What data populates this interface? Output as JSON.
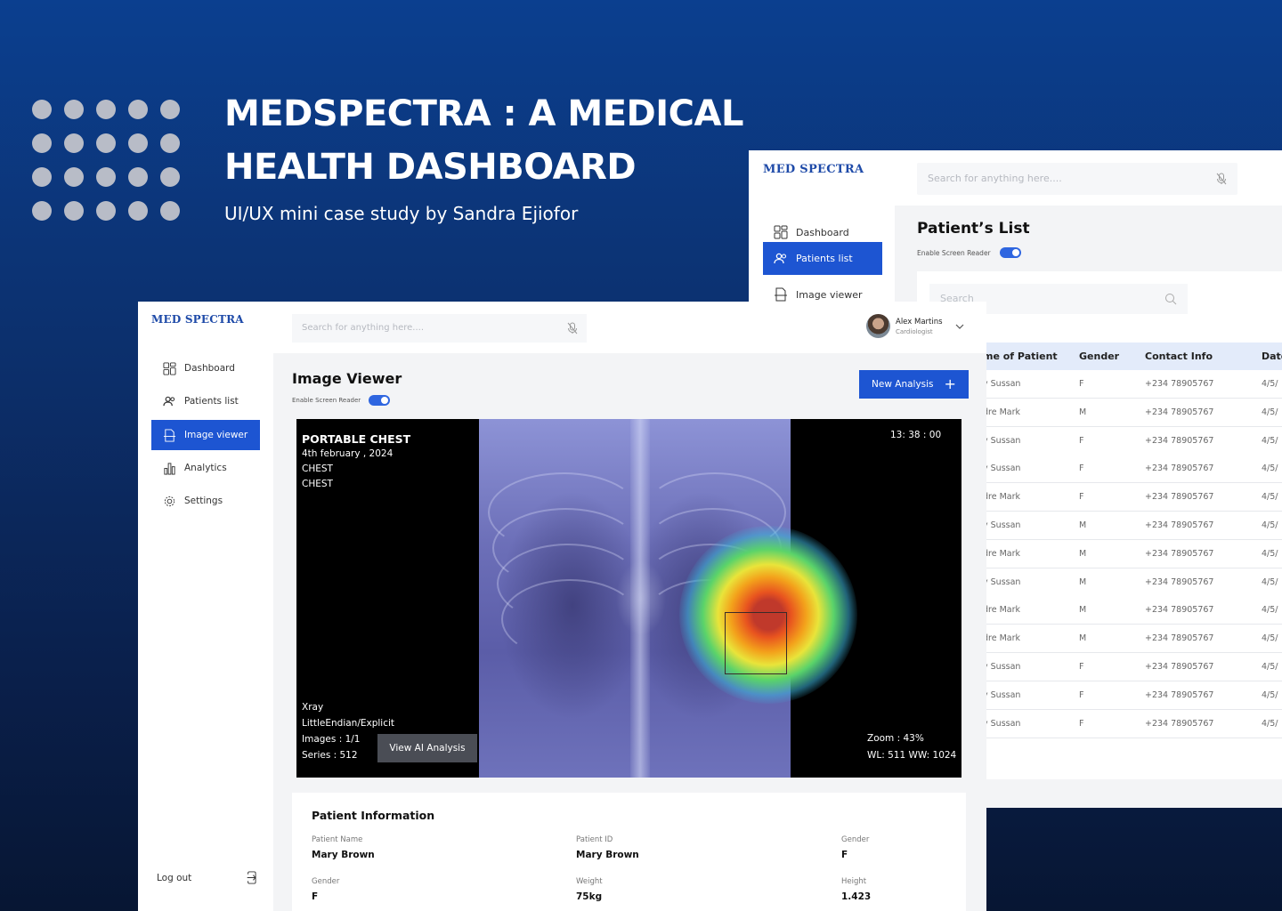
{
  "hero": {
    "title_line1": "MEDSPECTRA : A MEDICAL",
    "title_line2": "HEALTH DASHBOARD",
    "subtitle": "UI/UX mini case study by Sandra Ejiofor"
  },
  "colors": {
    "primary": "#1d55d2",
    "brand_logo": "#1e4aa8",
    "table_header_bg": "#e3ebfa",
    "bg_gradient_top": "#0b3f8f",
    "bg_gradient_bottom": "#071633"
  },
  "back_window": {
    "logo": "MED SPECTRA",
    "search_placeholder": "Search for anything here....",
    "nav": [
      {
        "label": "Dashboard",
        "icon": "dashboard-grid-icon"
      },
      {
        "label": "Patients list",
        "icon": "users-icon",
        "active": true
      },
      {
        "label": "Image viewer",
        "icon": "image-doc-icon"
      }
    ],
    "title": "Patient’s List",
    "screen_reader_label": "Enable Screen Reader",
    "table_search_placeholder": "Search",
    "columns": [
      "me of Patient",
      "Gender",
      "Contact Info",
      "Date"
    ],
    "rows": [
      [
        "y Sussan",
        "F",
        "+234 78905767",
        "4/5/"
      ],
      [
        "dre Mark",
        "M",
        "+234 78905767",
        "4/5/"
      ],
      [
        "y Sussan",
        "F",
        "+234 78905767",
        "4/5/"
      ],
      [
        "y Sussan",
        "F",
        "+234 78905767",
        "4/5/"
      ],
      [
        "dre Mark",
        "F",
        "+234 78905767",
        "4/5/"
      ],
      [
        "y Sussan",
        "M",
        "+234 78905767",
        "4/5/"
      ],
      [
        "dre Mark",
        "M",
        "+234 78905767",
        "4/5/"
      ],
      [
        "y Sussan",
        "M",
        "+234 78905767",
        "4/5/"
      ],
      [
        "dre Mark",
        "M",
        "+234 78905767",
        "4/5/"
      ],
      [
        "dre Mark",
        "M",
        "+234 78905767",
        "4/5/"
      ],
      [
        "y Sussan",
        "F",
        "+234 78905767",
        "4/5/"
      ],
      [
        "y Sussan",
        "F",
        "+234 78905767",
        "4/5/"
      ],
      [
        "y Sussan",
        "F",
        "+234 78905767",
        "4/5/"
      ]
    ]
  },
  "front_window": {
    "logo": "MED SPECTRA",
    "search_placeholder": "Search for anything here....",
    "user": {
      "name": "Alex Martins",
      "role": "Cardiologist"
    },
    "nav": [
      {
        "label": "Dashboard",
        "icon": "dashboard-grid-icon"
      },
      {
        "label": "Patients list",
        "icon": "users-icon"
      },
      {
        "label": "Image viewer",
        "icon": "image-doc-icon",
        "active": true
      },
      {
        "label": "Analytics",
        "icon": "bar-chart-icon"
      },
      {
        "label": "Settings",
        "icon": "gear-icon"
      }
    ],
    "logout_label": "Log out",
    "title": "Image Viewer",
    "screen_reader_label": "Enable Screen Reader",
    "new_analysis_label": "New Analysis",
    "viewer": {
      "title": "PORTABLE CHEST",
      "date": "4th february , 2024",
      "line1": "CHEST",
      "line2": "CHEST",
      "time": "13: 38 : 00",
      "modality": "Xray",
      "encoding": "LittleEndian/Explicit",
      "images": "Images : 1/1",
      "series": "Series : 512",
      "zoom": "Zoom : 43%",
      "window": "WL: 511 WW: 1024",
      "ai_button": "View AI Analysis"
    },
    "patient_info": {
      "heading": "Patient Information",
      "fields": [
        {
          "label": "Patient Name",
          "value": "Mary Brown"
        },
        {
          "label": "Patient ID",
          "value": "Mary Brown"
        },
        {
          "label": "Gender",
          "value": "F"
        },
        {
          "label": "Gender",
          "value": "F"
        },
        {
          "label": "Weight",
          "value": "75kg"
        },
        {
          "label": "Height",
          "value": "1.423"
        }
      ]
    }
  }
}
